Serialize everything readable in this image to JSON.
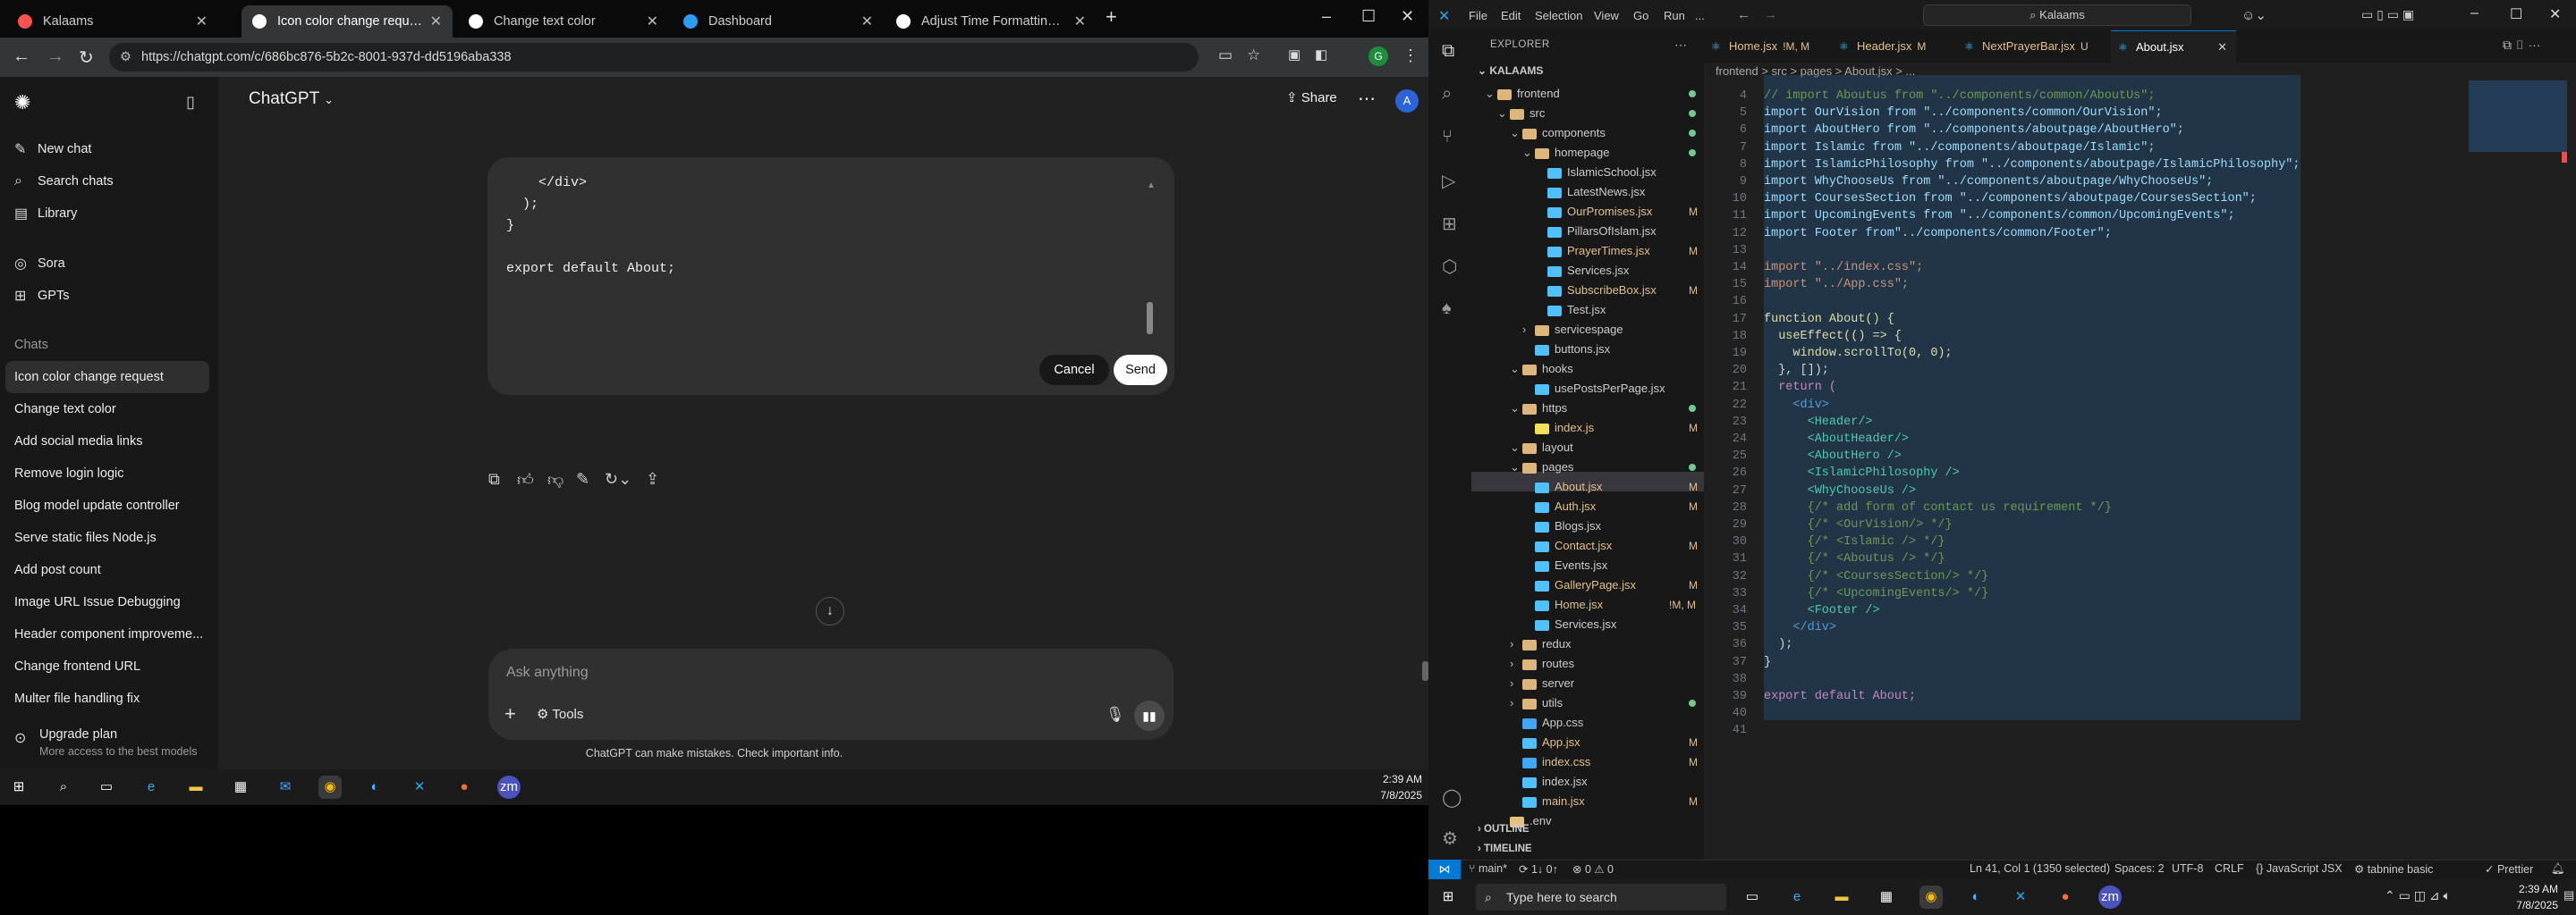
{
  "chrome": {
    "tabs": [
      {
        "title": "Kalaams",
        "active": false,
        "favicon_color": "#ff5050"
      },
      {
        "title": "Icon color change request",
        "active": true,
        "favicon_color": "#ffffff"
      },
      {
        "title": "Change text color",
        "active": false,
        "favicon_color": "#ffffff"
      },
      {
        "title": "Dashboard",
        "active": false,
        "favicon_color": "#2a9df4"
      },
      {
        "title": "Adjust Time Formatting for AM",
        "active": false,
        "favicon_color": "#ffffff"
      }
    ],
    "url": "https://chatgpt.com/c/686bc876-5b2c-8001-937d-dd5196aba338",
    "window_controls": [
      "–",
      "☐",
      "✕"
    ]
  },
  "chatgpt": {
    "sidebar": {
      "primary": [
        {
          "label": "New chat",
          "icon": "compose-icon"
        },
        {
          "label": "Search chats",
          "icon": "search-icon"
        },
        {
          "label": "Library",
          "icon": "library-icon"
        },
        {
          "label": "Sora",
          "icon": "sora-icon"
        },
        {
          "label": "GPTs",
          "icon": "grid-icon"
        }
      ],
      "section_label": "Chats",
      "chats": [
        "Icon color change request",
        "Change text color",
        "Add social media links",
        "Remove login logic",
        "Blog model update controller",
        "Serve static files Node.js",
        "Add post count",
        "Image URL Issue Debugging",
        "Header component improveme...",
        "Change frontend URL",
        "Multer file handling fix"
      ],
      "upgrade": {
        "title": "Upgrade plan",
        "subtitle": "More access to the best models"
      }
    },
    "header": {
      "title": "ChatGPT",
      "share_label": "Share",
      "avatar": "A"
    },
    "edit_box": {
      "lines": [
        "    </div>",
        "  );",
        "}",
        "",
        "export default About;"
      ],
      "cancel_label": "Cancel",
      "send_label": "Send"
    },
    "composer": {
      "placeholder": "Ask anything",
      "tools_label": "Tools"
    },
    "disclaimer": "ChatGPT can make mistakes. Check important info."
  },
  "vscode": {
    "menu": [
      "File",
      "Edit",
      "Selection",
      "View",
      "Go",
      "Run",
      "..."
    ],
    "search": "Kalaams",
    "explorer_title": "EXPLORER",
    "root": "KALAAMS",
    "tree": [
      {
        "label": "frontend",
        "depth": 0,
        "type": "folder",
        "open": true,
        "dot": "#73c991"
      },
      {
        "label": "src",
        "depth": 1,
        "type": "folder",
        "open": true,
        "dot": "#73c991"
      },
      {
        "label": "components",
        "depth": 2,
        "type": "folder",
        "open": true,
        "dot": "#73c991"
      },
      {
        "label": "homepage",
        "depth": 3,
        "type": "folder",
        "open": true,
        "dot": "#73c991"
      },
      {
        "label": "IslamicSchool.jsx",
        "depth": 4,
        "type": "file"
      },
      {
        "label": "LatestNews.jsx",
        "depth": 4,
        "type": "file"
      },
      {
        "label": "OurPromises.jsx",
        "depth": 4,
        "type": "file",
        "badge": "M"
      },
      {
        "label": "PillarsOfIslam.jsx",
        "depth": 4,
        "type": "file"
      },
      {
        "label": "PrayerTimes.jsx",
        "depth": 4,
        "type": "file",
        "badge": "M"
      },
      {
        "label": "Services.jsx",
        "depth": 4,
        "type": "file"
      },
      {
        "label": "SubscribeBox.jsx",
        "depth": 4,
        "type": "file",
        "badge": "M"
      },
      {
        "label": "Test.jsx",
        "depth": 4,
        "type": "file"
      },
      {
        "label": "servicespage",
        "depth": 3,
        "type": "folder",
        "open": false
      },
      {
        "label": "buttons.jsx",
        "depth": 3,
        "type": "file"
      },
      {
        "label": "hooks",
        "depth": 2,
        "type": "folder",
        "open": true
      },
      {
        "label": "usePostsPerPage.jsx",
        "depth": 3,
        "type": "file"
      },
      {
        "label": "https",
        "depth": 2,
        "type": "folder",
        "open": true,
        "dot": "#73c991"
      },
      {
        "label": "index.js",
        "depth": 3,
        "type": "file",
        "badge": "M"
      },
      {
        "label": "layout",
        "depth": 2,
        "type": "folder",
        "open": true
      },
      {
        "label": "pages",
        "depth": 2,
        "type": "folder",
        "open": true,
        "dot": "#73c991"
      },
      {
        "label": "About.jsx",
        "depth": 3,
        "type": "file",
        "badge": "M",
        "selected": true
      },
      {
        "label": "Auth.jsx",
        "depth": 3,
        "type": "file",
        "badge": "M"
      },
      {
        "label": "Blogs.jsx",
        "depth": 3,
        "type": "file"
      },
      {
        "label": "Contact.jsx",
        "depth": 3,
        "type": "file",
        "badge": "M"
      },
      {
        "label": "Events.jsx",
        "depth": 3,
        "type": "file"
      },
      {
        "label": "GalleryPage.jsx",
        "depth": 3,
        "type": "file",
        "badge": "M"
      },
      {
        "label": "Home.jsx",
        "depth": 3,
        "type": "file",
        "badge": "!M, M"
      },
      {
        "label": "Services.jsx",
        "depth": 3,
        "type": "file"
      },
      {
        "label": "redux",
        "depth": 2,
        "type": "folder",
        "open": false
      },
      {
        "label": "routes",
        "depth": 2,
        "type": "folder",
        "open": false
      },
      {
        "label": "server",
        "depth": 2,
        "type": "folder",
        "open": false
      },
      {
        "label": "utils",
        "depth": 2,
        "type": "folder",
        "open": false,
        "dot": "#73c991"
      },
      {
        "label": "App.css",
        "depth": 2,
        "type": "file"
      },
      {
        "label": "App.jsx",
        "depth": 2,
        "type": "file",
        "badge": "M"
      },
      {
        "label": "index.css",
        "depth": 2,
        "type": "file",
        "badge": "M"
      },
      {
        "label": "index.jsx",
        "depth": 2,
        "type": "file"
      },
      {
        "label": "main.jsx",
        "depth": 2,
        "type": "file",
        "badge": "M"
      },
      {
        "label": ".env",
        "depth": 1,
        "type": "file"
      }
    ],
    "outline_label": "OUTLINE",
    "timeline_label": "TIMELINE",
    "tabs": [
      {
        "label": "Home.jsx",
        "badge": "!M, M"
      },
      {
        "label": "Header.jsx",
        "badge": "M"
      },
      {
        "label": "NextPrayerBar.jsx",
        "badge": "U"
      },
      {
        "label": "About.jsx",
        "badge": "",
        "active": true
      }
    ],
    "breadcrumb": "frontend > src > pages > About.jsx > ...",
    "code": [
      {
        "n": "4",
        "t": "// import Aboutus from \"../components/common/AboutUs\";",
        "c": "#6a9955"
      },
      {
        "n": "5",
        "t": "import OurVision from \"../components/common/OurVision\";",
        "c": "#9cdcfe"
      },
      {
        "n": "6",
        "t": "import AboutHero from \"../components/aboutpage/AboutHero\";",
        "c": "#9cdcfe"
      },
      {
        "n": "7",
        "t": "import Islamic from \"../components/aboutpage/Islamic\";",
        "c": "#9cdcfe"
      },
      {
        "n": "8",
        "t": "import IslamicPhilosophy from \"../components/aboutpage/IslamicPhilosophy\";",
        "c": "#9cdcfe"
      },
      {
        "n": "9",
        "t": "import WhyChooseUs from \"../components/aboutpage/WhyChooseUs\";",
        "c": "#9cdcfe"
      },
      {
        "n": "10",
        "t": "import CoursesSection from \"../components/aboutpage/CoursesSection\";",
        "c": "#9cdcfe"
      },
      {
        "n": "11",
        "t": "import UpcomingEvents from \"../components/common/UpcomingEvents\";",
        "c": "#9cdcfe"
      },
      {
        "n": "12",
        "t": "import Footer from\"../components/common/Footer\";",
        "c": "#9cdcfe"
      },
      {
        "n": "13",
        "t": "",
        "c": "#ccc"
      },
      {
        "n": "14",
        "t": "import \"../index.css\";",
        "c": "#ce9178"
      },
      {
        "n": "15",
        "t": "import \"../App.css\";",
        "c": "#ce9178"
      },
      {
        "n": "16",
        "t": "",
        "c": "#ccc"
      },
      {
        "n": "17",
        "t": "function About() {",
        "c": "#dcdcaa"
      },
      {
        "n": "18",
        "t": "  useEffect(() => {",
        "c": "#dcdcaa"
      },
      {
        "n": "19",
        "t": "    window.scrollTo(0, 0);",
        "c": "#dcdcaa"
      },
      {
        "n": "20",
        "t": "  }, []);",
        "c": "#d4d4d4"
      },
      {
        "n": "21",
        "t": "  return (",
        "c": "#c586c0"
      },
      {
        "n": "22",
        "t": "    <div>",
        "c": "#569cd6"
      },
      {
        "n": "23",
        "t": "      <Header/>",
        "c": "#4ec9b0"
      },
      {
        "n": "24",
        "t": "      <AboutHeader/>",
        "c": "#4ec9b0"
      },
      {
        "n": "25",
        "t": "      <AboutHero />",
        "c": "#4ec9b0"
      },
      {
        "n": "26",
        "t": "      <IslamicPhilosophy />",
        "c": "#4ec9b0"
      },
      {
        "n": "27",
        "t": "      <WhyChooseUs />",
        "c": "#4ec9b0"
      },
      {
        "n": "28",
        "t": "      {/* add form of contact us requirement */}",
        "c": "#6a9955"
      },
      {
        "n": "29",
        "t": "      {/* <OurVision/> */}",
        "c": "#6a9955"
      },
      {
        "n": "30",
        "t": "      {/* <Islamic /> */}",
        "c": "#6a9955"
      },
      {
        "n": "31",
        "t": "      {/* <Aboutus /> */}",
        "c": "#6a9955"
      },
      {
        "n": "32",
        "t": "      {/* <CoursesSection/> */}",
        "c": "#6a9955"
      },
      {
        "n": "33",
        "t": "      {/* <UpcomingEvents/> */}",
        "c": "#6a9955"
      },
      {
        "n": "34",
        "t": "      <Footer />",
        "c": "#4ec9b0"
      },
      {
        "n": "35",
        "t": "    </div>",
        "c": "#569cd6"
      },
      {
        "n": "36",
        "t": "  );",
        "c": "#d4d4d4"
      },
      {
        "n": "37",
        "t": "}",
        "c": "#d4d4d4"
      },
      {
        "n": "38",
        "t": "",
        "c": "#ccc"
      },
      {
        "n": "39",
        "t": "export default About;",
        "c": "#c586c0"
      },
      {
        "n": "40",
        "t": "",
        "c": "#ccc"
      },
      {
        "n": "41",
        "t": "",
        "c": "#ccc"
      }
    ],
    "status": {
      "branch": "main*",
      "sync": "⟳ 1↓ 0↑",
      "problems": "⊗ 0 ⚠ 0",
      "position": "Ln 41, Col 1 (1350 selected)",
      "spaces": "Spaces: 2",
      "encoding": "UTF-8",
      "eol": "CRLF",
      "language": "{} JavaScript JSX",
      "tabnine": "tabnine basic",
      "prettier": "✓ Prettier"
    }
  },
  "taskbar": {
    "search_placeholder": "Type here to search",
    "time": "2:39 AM",
    "date": "7/8/2025"
  }
}
